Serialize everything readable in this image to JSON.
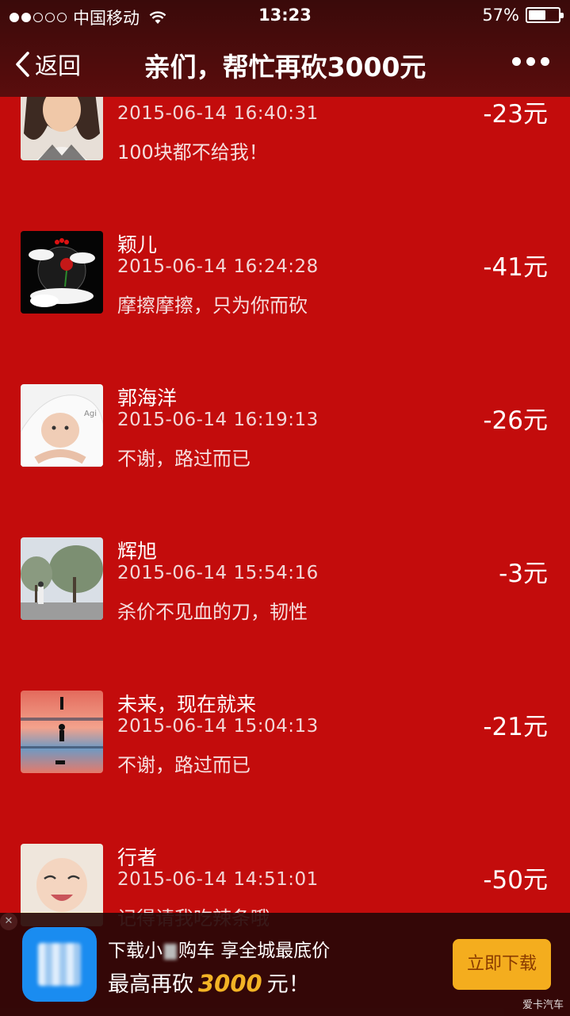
{
  "status": {
    "carrier": "中国移动",
    "time": "13:23",
    "battery": "57%",
    "battery_level": 0.57
  },
  "nav": {
    "back_label": "返回",
    "title": "亲们，帮忙再砍3000元"
  },
  "items": [
    {
      "name": "",
      "time": "2015-06-14 16:40:31",
      "comment": "100块都不给我！",
      "amount": "-23元"
    },
    {
      "name": "颖儿",
      "time": "2015-06-14 16:24:28",
      "comment": "摩擦摩擦，只为你而砍",
      "amount": "-41元"
    },
    {
      "name": "郭海洋",
      "time": "2015-06-14 16:19:13",
      "comment": "不谢，路过而已",
      "amount": "-26元"
    },
    {
      "name": "辉旭",
      "time": "2015-06-14 15:54:16",
      "comment": "杀价不见血的刀，韧性",
      "amount": "-3元"
    },
    {
      "name": "未来，现在就来",
      "time": "2015-06-14 15:04:13",
      "comment": "不谢，路过而已",
      "amount": "-21元"
    },
    {
      "name": "行者",
      "time": "2015-06-14 14:51:01",
      "comment": "记得请我吃辣条哦",
      "amount": "-50元"
    }
  ],
  "banner": {
    "line1_a": "下载小",
    "line1_b": "购车 享全城最底价",
    "line2_a": "最高再砍",
    "line2_value": "3000",
    "line2_b": "元！",
    "button_label": "立即下载",
    "accent": "#f4ad1e"
  },
  "watermark": "爱卡汽车"
}
